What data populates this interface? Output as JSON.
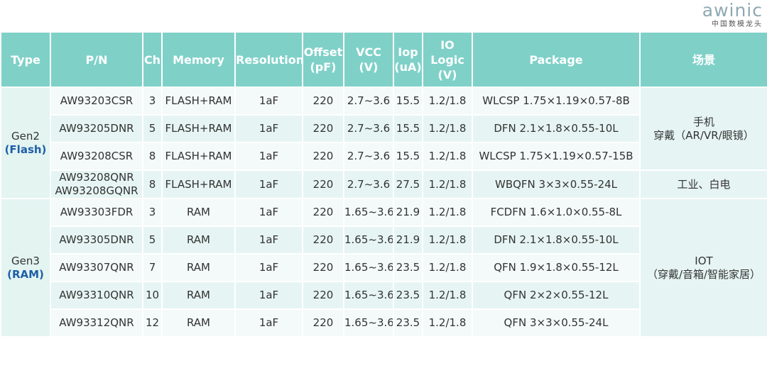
{
  "logo": {
    "wordmark": "awinic",
    "subtitle": "中国数模龙头"
  },
  "headers": [
    {
      "key": "type",
      "lines": [
        "Type"
      ]
    },
    {
      "key": "pn",
      "lines": [
        "P/N"
      ]
    },
    {
      "key": "ch",
      "lines": [
        "Ch"
      ]
    },
    {
      "key": "memory",
      "lines": [
        "Memory"
      ]
    },
    {
      "key": "resolution",
      "lines": [
        "Resolution"
      ]
    },
    {
      "key": "offset",
      "lines": [
        "Offset",
        "(pF)"
      ]
    },
    {
      "key": "vcc",
      "lines": [
        "VCC",
        "(V)"
      ]
    },
    {
      "key": "iop",
      "lines": [
        "Iop",
        "(uA)"
      ]
    },
    {
      "key": "io",
      "lines": [
        "IO Logic",
        "(V)"
      ]
    },
    {
      "key": "package",
      "lines": [
        "Package"
      ]
    },
    {
      "key": "scene",
      "lines": [
        "场景"
      ]
    }
  ],
  "groups": [
    {
      "type": "Gen2",
      "type_sub": "(Flash)",
      "rows": [
        {
          "pn": [
            "AW93203CSR"
          ],
          "ch": "3",
          "memory": "FLASH+RAM",
          "resolution": "1aF",
          "offset": "220",
          "vcc": "2.7~3.6",
          "iop": "15.5",
          "io": "1.2/1.8",
          "package": "WLCSP 1.75×1.19×0.57-8B"
        },
        {
          "pn": [
            "AW93205DNR"
          ],
          "ch": "5",
          "memory": "FLASH+RAM",
          "resolution": "1aF",
          "offset": "220",
          "vcc": "2.7~3.6",
          "iop": "15.5",
          "io": "1.2/1.8",
          "package": "DFN 2.1×1.8×0.55-10L"
        },
        {
          "pn": [
            "AW93208CSR"
          ],
          "ch": "8",
          "memory": "FLASH+RAM",
          "resolution": "1aF",
          "offset": "220",
          "vcc": "2.7~3.6",
          "iop": "15.5",
          "io": "1.2/1.8",
          "package": "WLCSP 1.75×1.19×0.57-15B"
        },
        {
          "pn": [
            "AW93208QNR",
            "AW93208GQNR"
          ],
          "ch": "8",
          "memory": "FLASH+RAM",
          "resolution": "1aF",
          "offset": "220",
          "vcc": "2.7~3.6",
          "iop": "27.5",
          "io": "1.2/1.8",
          "package": "WBQFN 3×3×0.55-24L"
        }
      ],
      "apps": [
        {
          "lines": [
            "手机",
            "穿戴（AR/VR/眼镜）"
          ],
          "span": 3
        },
        {
          "lines": [
            "工业、白电"
          ],
          "span": 1
        }
      ]
    },
    {
      "type": "Gen3",
      "type_sub": "(RAM)",
      "rows": [
        {
          "pn": [
            "AW93303FDR"
          ],
          "ch": "3",
          "memory": "RAM",
          "resolution": "1aF",
          "offset": "220",
          "vcc": "1.65~3.6",
          "iop": "21.9",
          "io": "1.2/1.8",
          "package": "FCDFN 1.6×1.0×0.55-8L"
        },
        {
          "pn": [
            "AW93305DNR"
          ],
          "ch": "5",
          "memory": "RAM",
          "resolution": "1aF",
          "offset": "220",
          "vcc": "1.65~3.6",
          "iop": "21.9",
          "io": "1.2/1.8",
          "package": "DFN 2.1×1.8×0.55-10L"
        },
        {
          "pn": [
            "AW93307QNR"
          ],
          "ch": "7",
          "memory": "RAM",
          "resolution": "1aF",
          "offset": "220",
          "vcc": "1.65~3.6",
          "iop": "23.5",
          "io": "1.2/1.8",
          "package": "QFN 1.9×1.8×0.55-12L"
        },
        {
          "pn": [
            "AW93310QNR"
          ],
          "ch": "10",
          "memory": "RAM",
          "resolution": "1aF",
          "offset": "220",
          "vcc": "1.65~3.6",
          "iop": "23.5",
          "io": "1.2/1.8",
          "package": "QFN 2×2×0.55-12L"
        },
        {
          "pn": [
            "AW93312QNR"
          ],
          "ch": "12",
          "memory": "RAM",
          "resolution": "1aF",
          "offset": "220",
          "vcc": "1.65~3.6",
          "iop": "23.5",
          "io": "1.2/1.8",
          "package": "QFN 3×3×0.55-24L"
        }
      ],
      "apps": [
        {
          "lines": [
            "IOT",
            "（穿戴/音箱/智能家居）"
          ],
          "span": 5
        }
      ]
    }
  ],
  "colors": {
    "header_bg": "#7fd1c8",
    "row_light": "#f3faf9",
    "row_dark": "#e6f5f3",
    "type_accent": "#1f5ea8",
    "logo": "#8fa9b3"
  }
}
